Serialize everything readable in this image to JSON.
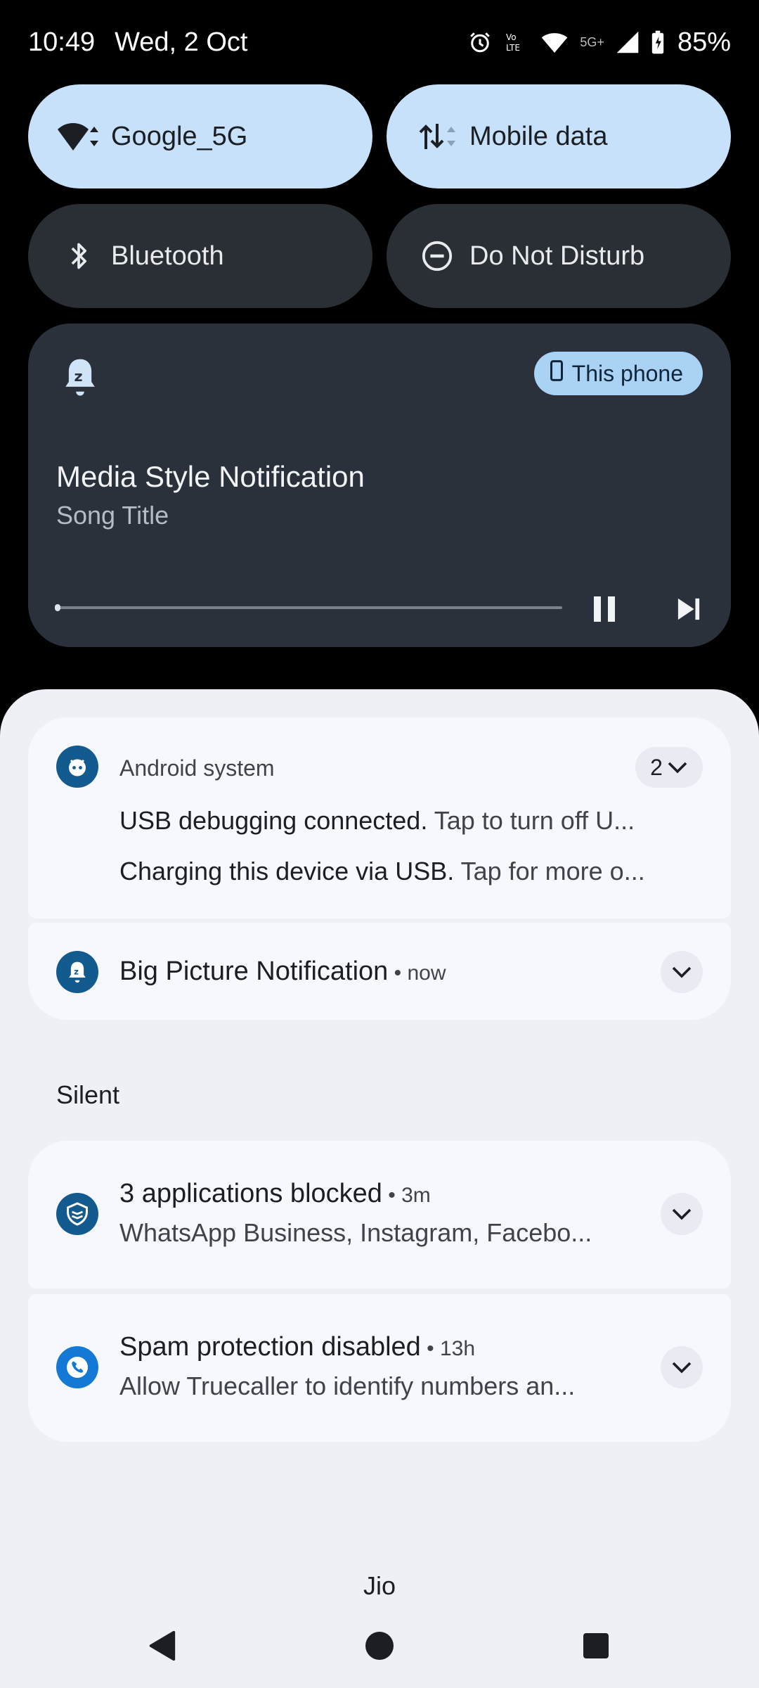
{
  "status_bar": {
    "time": "10:49",
    "date": "Wed, 2 Oct",
    "network_label": "5G+",
    "battery": "85%"
  },
  "quick_settings": {
    "wifi": {
      "label": "Google_5G",
      "state": "on"
    },
    "mobile_data": {
      "label": "Mobile data",
      "state": "on"
    },
    "bluetooth": {
      "label": "Bluetooth",
      "state": "off"
    },
    "dnd": {
      "label": "Do Not Disturb",
      "state": "off"
    }
  },
  "media": {
    "output_chip": "This phone",
    "title": "Media Style Notification",
    "subtitle": "Song Title",
    "progress": 0.0
  },
  "notifications": {
    "android_system": {
      "app_name": "Android system",
      "count": "2",
      "lines": [
        {
          "title": "USB debugging connected.",
          "text": "Tap to turn off U..."
        },
        {
          "title": "Charging this device via USB.",
          "text": "Tap for more o..."
        }
      ]
    },
    "big_picture": {
      "title": "Big Picture Notification",
      "time": " • now"
    },
    "silent_label": "Silent",
    "blocked": {
      "title": "3 applications blocked",
      "time": " • 3m",
      "text": "WhatsApp Business, Instagram, Facebo..."
    },
    "spam": {
      "title": "Spam protection disabled",
      "time": " • 13h",
      "text": "Allow Truecaller to identify numbers an..."
    }
  },
  "carrier": "Jio",
  "colors": {
    "tile_on": "#c7e1fa",
    "tile_off": "#2a2f35",
    "media_card": "#2a313b",
    "shade": "#eef0f6",
    "card": "#f7f8fd",
    "app_icon": "#135b8e"
  }
}
